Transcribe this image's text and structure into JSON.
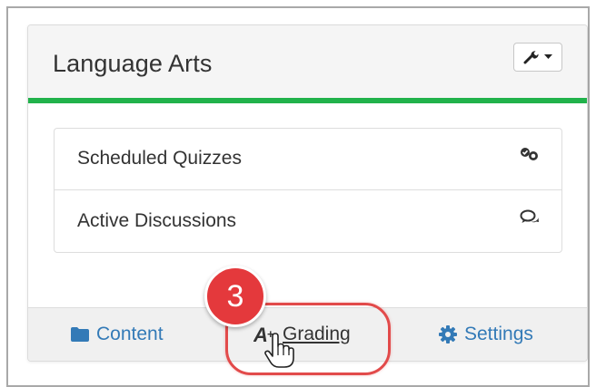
{
  "course": {
    "title": "Language Arts",
    "accent_color": "#21b24b",
    "tool_menu_icon": "wrench-icon"
  },
  "list": {
    "items": [
      {
        "label": "Scheduled Quizzes",
        "icon": "quizzes-icon"
      },
      {
        "label": "Active Discussions",
        "icon": "comments-icon"
      }
    ]
  },
  "footer": {
    "content_label": "Content",
    "grading_label": "Grading",
    "settings_label": "Settings",
    "link_color": "#337ab7"
  },
  "annotation": {
    "step_number": "3",
    "highlight_color": "#e24a4a"
  }
}
